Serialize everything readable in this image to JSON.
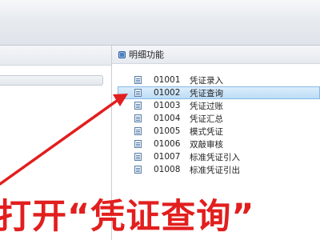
{
  "detail_panel": {
    "title": "明细功能",
    "items": [
      {
        "code": "01001",
        "name": "凭证录入",
        "selected": false
      },
      {
        "code": "01002",
        "name": "凭证查询",
        "selected": true
      },
      {
        "code": "01003",
        "name": "凭证过账",
        "selected": false
      },
      {
        "code": "01004",
        "name": "凭证汇总",
        "selected": false
      },
      {
        "code": "01005",
        "name": "模式凭证",
        "selected": false
      },
      {
        "code": "01006",
        "name": "双敲审核",
        "selected": false
      },
      {
        "code": "01007",
        "name": "标准凭证引入",
        "selected": false
      },
      {
        "code": "01008",
        "name": "标准凭证引出",
        "selected": false
      }
    ]
  },
  "annotation": {
    "text": "打开“凭证查询”",
    "color": "#e21e1e"
  },
  "colors": {
    "selection": "#bcdcf6",
    "icon_accent": "#4a7fc0"
  }
}
